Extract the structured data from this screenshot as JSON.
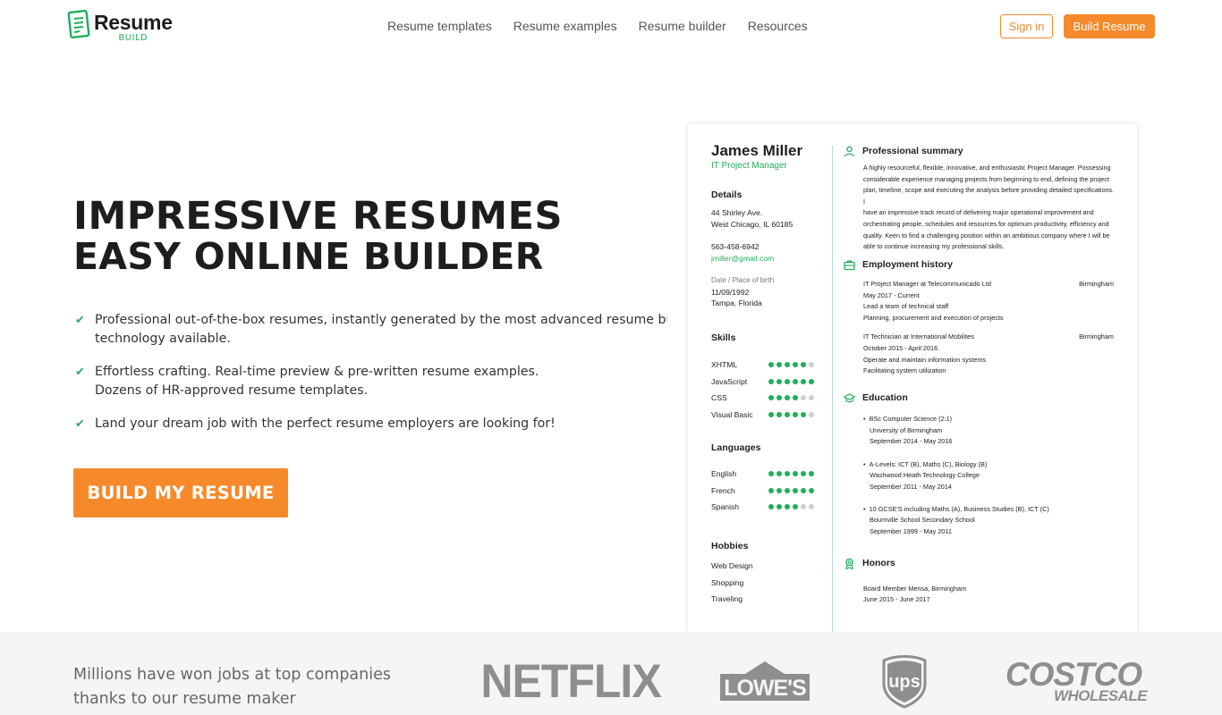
{
  "header": {
    "logo_main": "Resume",
    "logo_sub": "BUILD",
    "nav": [
      "Resume templates",
      "Resume examples",
      "Resume builder",
      "Resources"
    ],
    "sign_in": "Sign in",
    "build_resume": "Build Resume"
  },
  "hero": {
    "headline_1": "IMPRESSIVE RESUMES",
    "headline_2": "EASY ONLINE BUILDER",
    "features": [
      [
        "Professional out-of-the-box resumes, instantly generated by the most advanced resume builder",
        "technology available."
      ],
      [
        "Effortless crafting. Real-time preview & pre-written resume examples.",
        "Dozens of HR-approved resume templates."
      ],
      [
        "Land your dream job with the perfect resume employers are looking for!"
      ]
    ],
    "cta": "BUILD MY RESUME"
  },
  "resume": {
    "name": "James Miller",
    "title": "IT Project Manager",
    "details_heading": "Details",
    "address_1": "44 Shirley Ave.",
    "address_2": "West Chicago, IL 60185",
    "phone": "563-458-6942",
    "email": "jmiller@gmail.com",
    "dob_label": "Date / Place of birth",
    "dob": "11/09/1992",
    "pob": "Tampa, Florida",
    "skills_heading": "Skills",
    "skills": [
      {
        "name": "XHTML",
        "level": 5
      },
      {
        "name": "JavaScript",
        "level": 6
      },
      {
        "name": "CSS",
        "level": 4
      },
      {
        "name": "Visual Basic",
        "level": 5
      }
    ],
    "languages_heading": "Languages",
    "languages": [
      {
        "name": "English",
        "level": 6
      },
      {
        "name": "French",
        "level": 6
      },
      {
        "name": "Spanish",
        "level": 4
      }
    ],
    "hobbies_heading": "Hobbies",
    "hobbies": [
      "Web Design",
      "Shopping",
      "Traveling"
    ],
    "summary_heading": "Professional summary",
    "summary_lines": [
      "A highly resourceful, flexible, innovative, and enthusiastic Project Manager. Possessing",
      "considerable experience managing projects from beginning to end, defining the project",
      "plan, timeline, scope and executing the analysis before providing detailed specifications. I",
      "have an impressive track record of delivering major operational improvement and",
      "orchestrating people, schedules and resources for optimum productivity, efficiency and",
      "quality. Keen to find a challenging position within an ambitious company where I will be",
      "able to continue increasing my professional skills."
    ],
    "employment_heading": "Employment history",
    "jobs": [
      {
        "title": "IT Project Manager at Telecommunicado Ltd",
        "location": "Birmingham",
        "dates": "May 2017 - Current",
        "bullets": [
          "Lead a team of technical staff",
          "Planning, procurement and execution of projects"
        ]
      },
      {
        "title": "IT Technician at International Mobilites",
        "location": "Birmingham",
        "dates": "October 2015 - April 2016",
        "bullets": [
          "Operate and maintain information systems",
          "Facilitating system utilization"
        ]
      }
    ],
    "education_heading": "Education",
    "education": [
      {
        "degree": "BSc Computer Science (2:1)",
        "school": "University of Birmingham",
        "dates": "September 2014 - May 2016"
      },
      {
        "degree": "A-Levels: ICT (B), Maths (C), Biology (B)",
        "school": "Washwood Heath Technology College",
        "dates": "September 2011 - May 2014"
      },
      {
        "degree": "10 GCSE'S including Maths (A), Business Studies (B), ICT (C)",
        "school": "Bournville School Secondary School",
        "dates": "September 1999 - May 2011"
      }
    ],
    "honors_heading": "Honors",
    "honor": "Board Member Mensa, Birmingham",
    "honor_dates": "June 2015 - June 2017"
  },
  "band": {
    "text_1": "Millions have won jobs at top companies",
    "text_2": "thanks to our resume maker",
    "brands": {
      "netflix": "NETFLIX",
      "lowes": "LOWE'S",
      "ups": "ups",
      "costco_top": "COSTCO",
      "costco_bottom": "WHOLESALE"
    }
  },
  "colors": {
    "accent": "#f68a2b",
    "green": "#1fae5b",
    "band_bg": "#f5f5f5",
    "brand_gray": "#8e8e8e"
  }
}
